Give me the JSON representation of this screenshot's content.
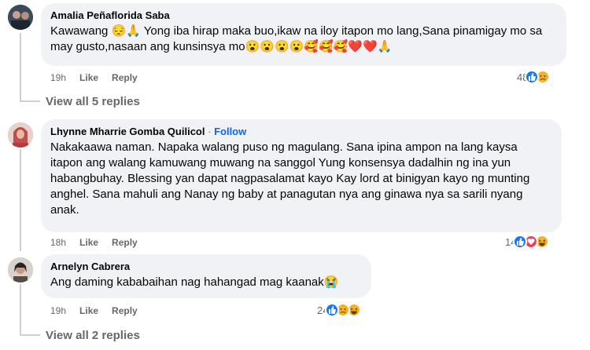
{
  "comments": [
    {
      "author": "Amalia Peñaflorida Saba",
      "text": "Kawawang 😔🙏 Yong iba hirap maka buo,ikaw na iloy itapon mo lang,Sana pinamigay mo sa may gusto,nasaan ang kunsinsya mo😮😮😮😮🥰🥰🥰❤️❤️🙏",
      "time": "19h",
      "like": "Like",
      "reply": "Reply",
      "reaction_count": "48",
      "reactions": [
        "like-icon",
        "sad-icon"
      ]
    },
    {
      "author": "Lhynne Mharrie Gomba Quilicol",
      "separator": "·",
      "follow": "Follow",
      "text": "Nakakaawa naman. Napaka walang puso ng magulang. Sana ipina ampon na lang kaysa itapon ang walang kamuwang muwang na sanggol Yung konsensya dadalhin ng ina yun habangbuhay. Blessing yan dapat nagpasalamat kayo Kay lord at binigyan kayo ng munting anghel. Sana mahuli ang Nanay ng baby at panagutan nya ang ginawa nya sa sarili nyang anak.",
      "time": "18h",
      "like": "Like",
      "reply": "Reply",
      "reaction_count": "14",
      "reactions": [
        "like-icon",
        "heart-icon",
        "haha-icon"
      ]
    },
    {
      "author": "Arnelyn Cabrera",
      "text": "Ang daming kababaihan nag hahangad mag kaanak😭",
      "time": "19h",
      "like": "Like",
      "reply": "Reply",
      "reaction_count": "24",
      "reactions": [
        "like-icon",
        "sad-icon",
        "haha-icon"
      ]
    }
  ],
  "view_replies": [
    "View all 5 replies",
    "View all 2 replies"
  ],
  "colors": {
    "bubble": "#f0f2f5",
    "meta": "#65676b",
    "link": "#0866ff",
    "like": "#1877f2"
  }
}
